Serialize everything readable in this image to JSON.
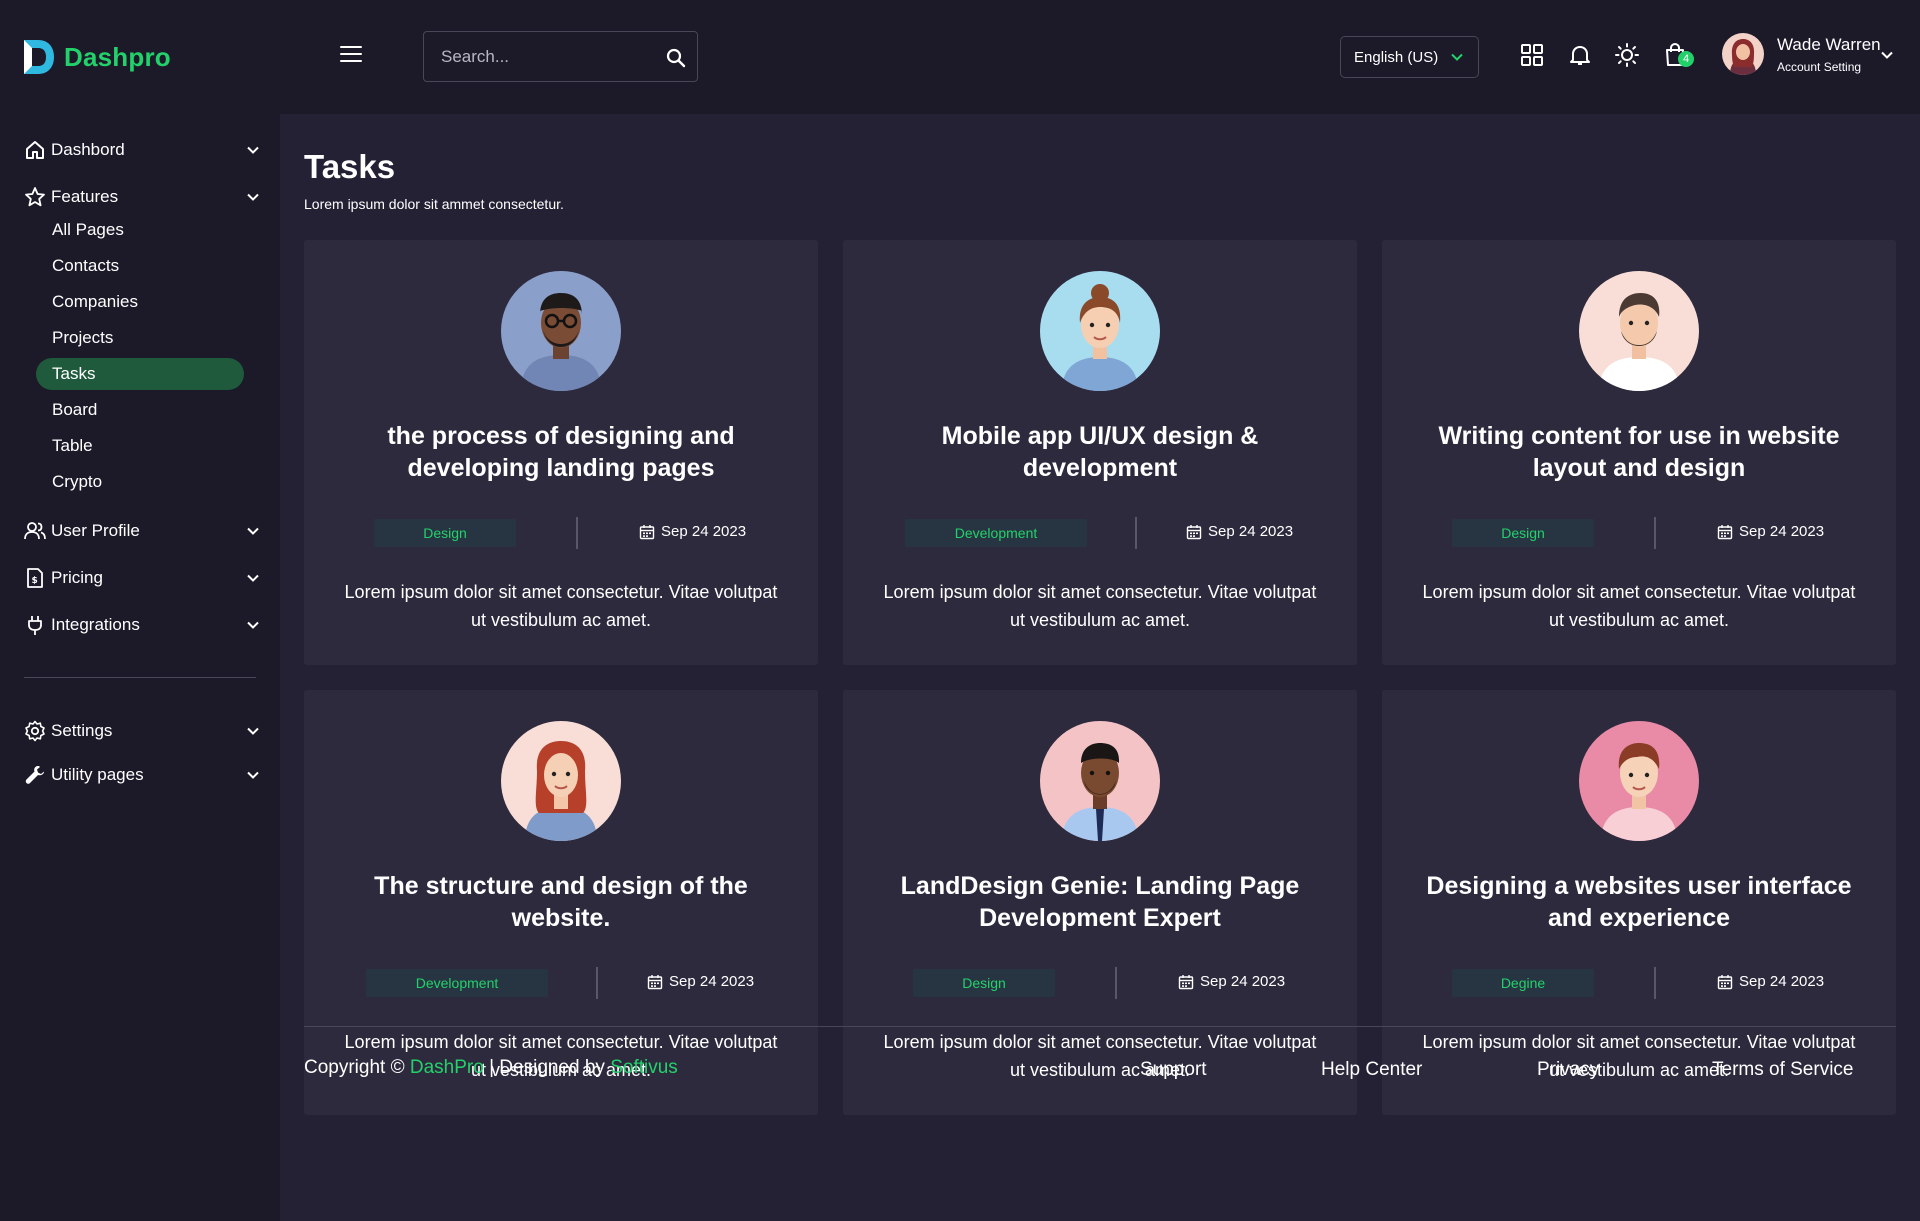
{
  "brand": {
    "name": "Dashpro",
    "accent": "#23d16b"
  },
  "header": {
    "search_placeholder": "Search...",
    "language": "English (US)",
    "cart_count": "4",
    "user_name": "Wade Warren",
    "user_sub": "Account Setting"
  },
  "sidebar": {
    "items": [
      {
        "label": "Dashbord",
        "icon": "home-icon"
      },
      {
        "label": "Features",
        "icon": "star-icon"
      },
      {
        "label": "User Profile",
        "icon": "users-icon"
      },
      {
        "label": "Pricing",
        "icon": "price-doc-icon"
      },
      {
        "label": "Integrations",
        "icon": "plug-icon"
      },
      {
        "label": "Settings",
        "icon": "gear-icon"
      },
      {
        "label": "Utility pages",
        "icon": "wrench-icon"
      }
    ],
    "features_sub": [
      "All Pages",
      "Contacts",
      "Companies",
      "Projects",
      "Tasks",
      "Board",
      "Table",
      "Crypto"
    ],
    "active_sub": "Tasks"
  },
  "main": {
    "title": "Tasks",
    "subtitle": "Lorem ipsum dolor sit ammet consectetur.",
    "cards": [
      {
        "title": "the process of designing and developing landing pages",
        "tag": "Design",
        "date": "Sep 24 2023",
        "desc": "Lorem ipsum dolor sit amet consectetur. Vitae volutpat ut vestibulum ac amet."
      },
      {
        "title": "Mobile app UI/UX design & development",
        "tag": "Development",
        "date": "Sep 24 2023",
        "desc": "Lorem ipsum dolor sit amet consectetur. Vitae volutpat ut vestibulum ac amet."
      },
      {
        "title": "Writing content for use in website layout and design",
        "tag": "Design",
        "date": "Sep 24 2023",
        "desc": "Lorem ipsum dolor sit amet consectetur. Vitae volutpat ut vestibulum ac amet."
      },
      {
        "title": "The structure and design of the website.",
        "tag": "Development",
        "date": "Sep 24 2023",
        "desc": "Lorem ipsum dolor sit amet consectetur. Vitae volutpat ut vestibulum ac amet."
      },
      {
        "title": "LandDesign Genie: Landing Page Development Expert",
        "tag": "Design",
        "date": "Sep 24 2023",
        "desc": "Lorem ipsum dolor sit amet consectetur. Vitae volutpat ut vestibulum ac amet."
      },
      {
        "title": "Designing a websites user interface and experience",
        "tag": "Degine",
        "date": "Sep 24 2023",
        "desc": "Lorem ipsum dolor sit amet consectetur. Vitae volutpat ut vestibulum ac amet."
      }
    ]
  },
  "footer": {
    "copyright_prefix": "Copyright ©",
    "brand": "DashPro",
    "designed_by": "| Designed by",
    "company": "Softivus",
    "links": [
      "Support",
      "Help Center",
      "Privacy",
      "Terms of Service"
    ]
  }
}
